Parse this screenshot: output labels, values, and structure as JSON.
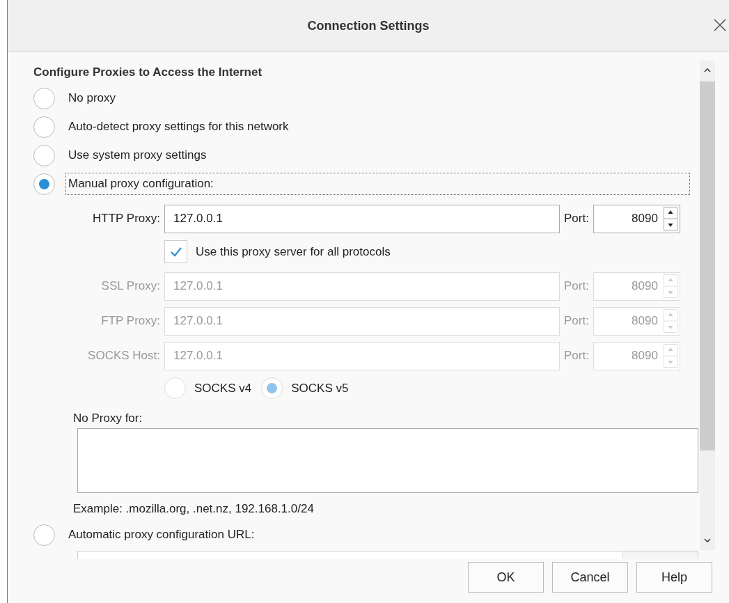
{
  "window": {
    "title": "Connection Settings"
  },
  "heading": "Configure Proxies to Access the Internet",
  "proxy_modes": [
    {
      "label": "No proxy",
      "selected": false,
      "focused": false
    },
    {
      "label": "Auto-detect proxy settings for this network",
      "selected": false,
      "focused": false
    },
    {
      "label": "Use system proxy settings",
      "selected": false,
      "focused": false
    },
    {
      "label": "Manual proxy configuration:",
      "selected": true,
      "focused": true
    }
  ],
  "proxies": [
    {
      "label": "HTTP Proxy:",
      "value": "127.0.0.1",
      "port_label": "Port:",
      "port": "8090",
      "disabled": false
    },
    {
      "label": "SSL Proxy:",
      "value": "127.0.0.1",
      "port_label": "Port:",
      "port": "8090",
      "disabled": true
    },
    {
      "label": "FTP Proxy:",
      "value": "127.0.0.1",
      "port_label": "Port:",
      "port": "8090",
      "disabled": true
    },
    {
      "label": "SOCKS Host:",
      "value": "127.0.0.1",
      "port_label": "Port:",
      "port": "8090",
      "disabled": true
    }
  ],
  "share_all": {
    "label": "Use this proxy server for all protocols",
    "checked": true
  },
  "socks_versions": [
    {
      "label": "SOCKS v4",
      "selected": false,
      "disabled": true
    },
    {
      "label": "SOCKS v5",
      "selected": true,
      "disabled": true
    }
  ],
  "no_proxy": {
    "label": "No Proxy for:",
    "hint": "Example: .mozilla.org, .net.nz, 192.168.1.0/24"
  },
  "auto_config": {
    "label": "Automatic proxy configuration URL:",
    "selected": false
  },
  "buttons": [
    {
      "label": "OK"
    },
    {
      "label": "Cancel"
    },
    {
      "label": "Help"
    }
  ]
}
